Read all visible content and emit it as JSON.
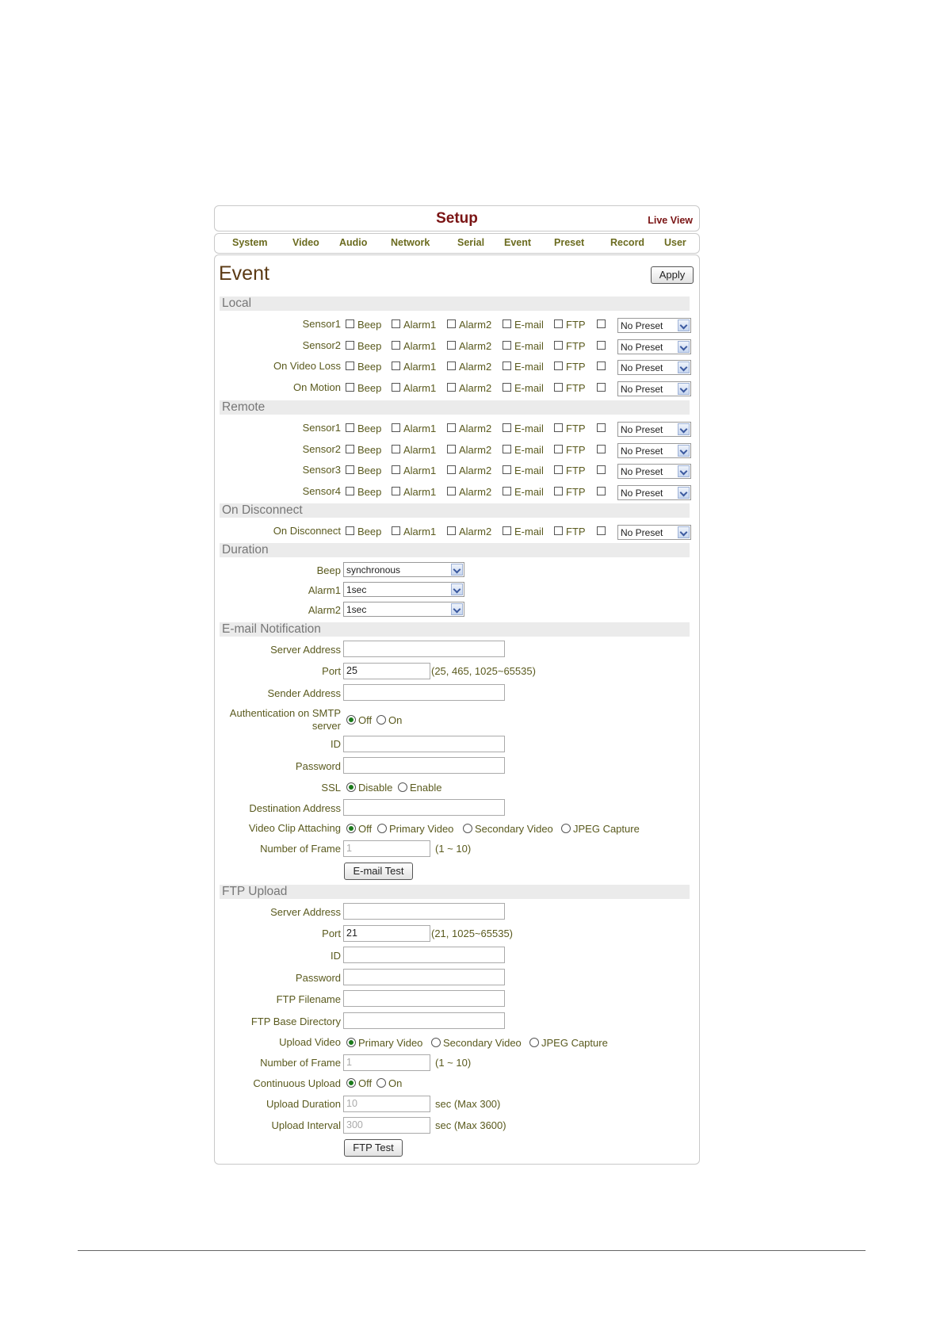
{
  "header": {
    "title": "Setup",
    "live_view": "Live View"
  },
  "tabs": [
    "System",
    "Video",
    "Audio",
    "Network",
    "Serial",
    "Event",
    "Preset",
    "Record",
    "User"
  ],
  "page": {
    "title": "Event",
    "apply": "Apply"
  },
  "common": {
    "beep": "Beep",
    "alarm1": "Alarm1",
    "alarm2": "Alarm2",
    "email": "E-mail",
    "ftp": "FTP",
    "preset": "No Preset"
  },
  "sections": {
    "local": "Local",
    "remote": "Remote",
    "disconnect": "On Disconnect",
    "duration": "Duration",
    "email": "E-mail Notification",
    "ftp": "FTP Upload"
  },
  "local_rows": [
    "Sensor1",
    "Sensor2",
    "On Video Loss",
    "On Motion"
  ],
  "remote_rows": [
    "Sensor1",
    "Sensor2",
    "Sensor3",
    "Sensor4"
  ],
  "disconnect_rows": [
    "On Disconnect"
  ],
  "duration": {
    "beep_label": "Beep",
    "beep_value": "synchronous",
    "alarm1_label": "Alarm1",
    "alarm1_value": "1sec",
    "alarm2_label": "Alarm2",
    "alarm2_value": "1sec"
  },
  "email": {
    "server_label": "Server Address",
    "server_value": "",
    "port_label": "Port",
    "port_value": "25",
    "port_hint": "(25, 465, 1025~65535)",
    "sender_label": "Sender Address",
    "sender_value": "",
    "auth_label_1": "Authentication on SMTP",
    "auth_label_2": "server",
    "auth_off": "Off",
    "auth_on": "On",
    "id_label": "ID",
    "id_value": "",
    "password_label": "Password",
    "password_value": "",
    "ssl_label": "SSL",
    "ssl_disable": "Disable",
    "ssl_enable": "Enable",
    "dest_label": "Destination Address",
    "dest_value": "",
    "clip_label": "Video Clip Attaching",
    "clip_off": "Off",
    "clip_primary": "Primary Video",
    "clip_secondary": "Secondary Video",
    "clip_jpeg": "JPEG Capture",
    "frames_label": "Number of Frame",
    "frames_value": "1",
    "frames_hint": "(1 ~ 10)",
    "test_button": "E-mail Test"
  },
  "ftp": {
    "server_label": "Server Address",
    "server_value": "",
    "port_label": "Port",
    "port_value": "21",
    "port_hint": "(21, 1025~65535)",
    "id_label": "ID",
    "id_value": "",
    "password_label": "Password",
    "password_value": "",
    "filename_label": "FTP Filename",
    "filename_value": "",
    "basedir_label": "FTP Base Directory",
    "basedir_value": "",
    "upload_label": "Upload Video",
    "upload_primary": "Primary Video",
    "upload_secondary": "Secondary Video",
    "upload_jpeg": "JPEG Capture",
    "frames_label": "Number of Frame",
    "frames_value": "1",
    "frames_hint": "(1 ~ 10)",
    "continuous_label": "Continuous Upload",
    "continuous_off": "Off",
    "continuous_on": "On",
    "duration_label": "Upload Duration",
    "duration_value": "10",
    "duration_hint": "sec (Max 300)",
    "interval_label": "Upload Interval",
    "interval_value": "300",
    "interval_hint": "sec (Max 3600)",
    "test_button": "FTP Test"
  }
}
